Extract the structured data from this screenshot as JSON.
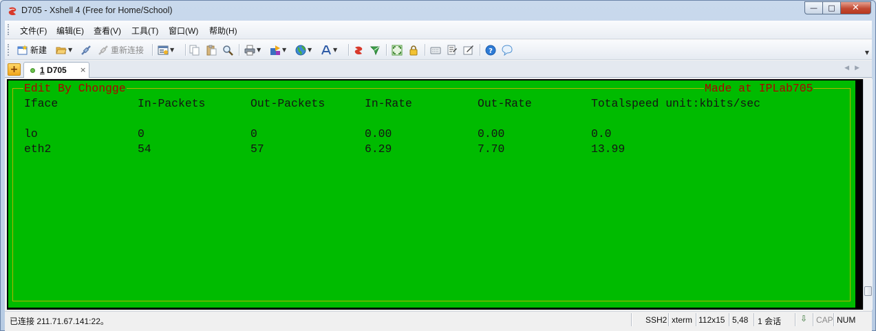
{
  "window": {
    "title": "D705 - Xshell 4 (Free for Home/School)"
  },
  "menu": [
    "文件(F)",
    "编辑(E)",
    "查看(V)",
    "工具(T)",
    "窗口(W)",
    "帮助(H)"
  ],
  "toolbar": {
    "new_label": "新建",
    "reconnect_label": "重新连接"
  },
  "tab": {
    "number": "1",
    "name": "D705",
    "close": "×"
  },
  "terminal": {
    "banner_left": "Edit By Chongge",
    "banner_right": "Made at IPLab705",
    "headers": [
      "Iface",
      "In-Packets",
      "Out-Packets",
      "In-Rate",
      "Out-Rate",
      "Totalspeed unit:kbits/sec"
    ],
    "rows": [
      [
        "lo",
        "0",
        "0",
        "0.00",
        "0.00",
        "0.0"
      ],
      [
        "eth2",
        "54",
        "57",
        "6.29",
        "7.70",
        "13.99"
      ]
    ]
  },
  "status": {
    "connection": "已连接 211.71.67.141:22。",
    "protocol": "SSH2",
    "terminal_type": "xterm",
    "size": "112x15",
    "cursor": "5,48",
    "sessions": "1 会话",
    "caps": "CAP",
    "num": "NUM"
  },
  "colors": {
    "terminal_bg": "#00bb00",
    "terminal_fg": "#141414",
    "banner": "#b00000",
    "frame": "#b4b400"
  },
  "icons": [
    "xshell-logo-icon",
    "new-session-icon",
    "open-folder-icon",
    "connect-icon",
    "reconnect-icon",
    "properties-icon",
    "copy-icon",
    "paste-icon",
    "find-icon",
    "print-icon",
    "transfer-icon",
    "globe-icon",
    "font-icon",
    "xshell-icon",
    "xftp-icon",
    "fullscreen-icon",
    "lock-icon",
    "keyboard-icon",
    "script-icon",
    "compose-icon",
    "help-icon",
    "chat-icon"
  ]
}
